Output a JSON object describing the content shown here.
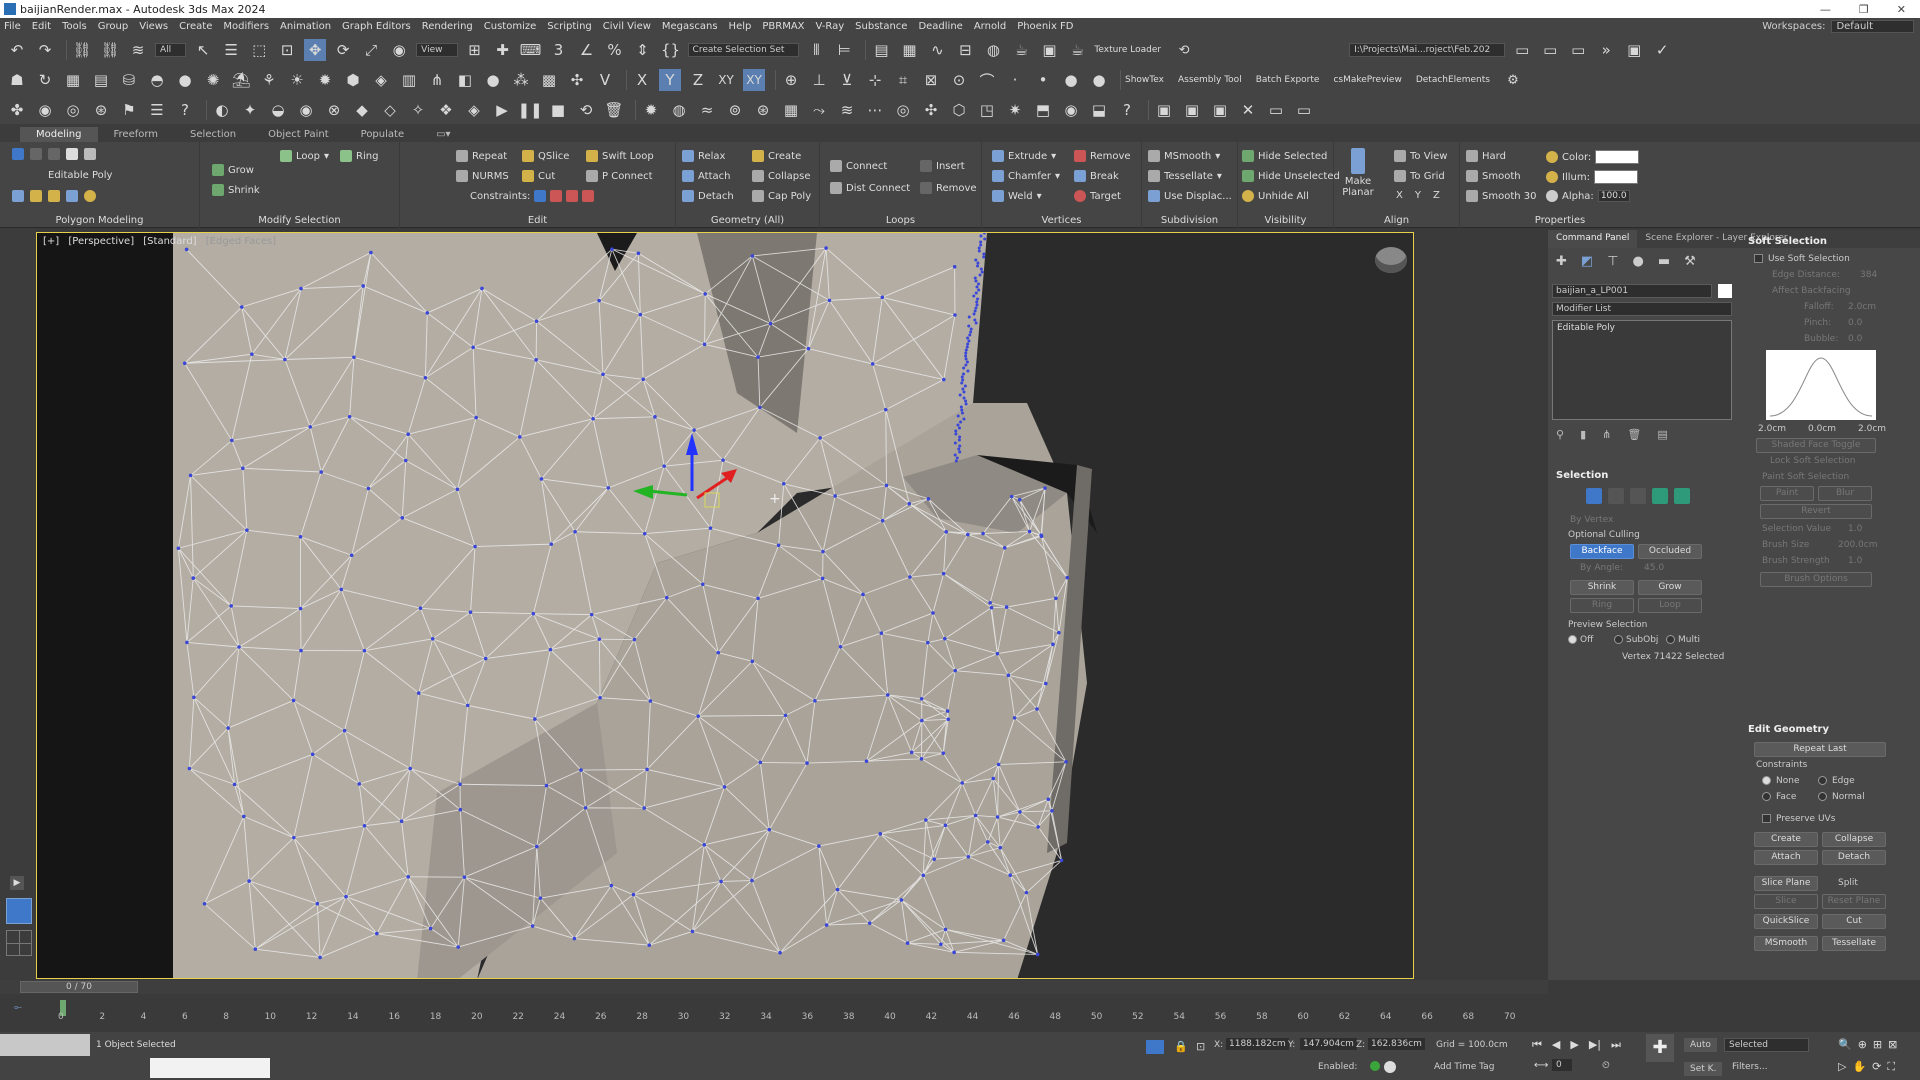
{
  "title": "baijianRender.max - Autodesk 3ds Max 2024",
  "menu": [
    "File",
    "Edit",
    "Tools",
    "Group",
    "Views",
    "Create",
    "Modifiers",
    "Animation",
    "Graph Editors",
    "Rendering",
    "Customize",
    "Scripting",
    "Civil View",
    "Megascans",
    "Help",
    "PBRMAX",
    "V-Ray",
    "Substance",
    "Deadline",
    "Arnold",
    "Phoenix FD"
  ],
  "workspace": {
    "label": "Workspaces:",
    "value": "Default"
  },
  "toolbar1": {
    "selection_filter": "All",
    "ref_coord": "View",
    "selection_set": "Create Selection Set",
    "texture_loader": "Texture Loader",
    "project_path": "I:\\Projects\\Mai...roject\\Feb.202"
  },
  "toolbar2": {
    "show_tex": "ShowTex",
    "assembly_tool": "Assembly Tool",
    "batch_export": "Batch Exporte",
    "cs_make_preview": "csMakePreview",
    "detach_elements": "DetachElements",
    "axis_x": "X",
    "axis_y": "Y",
    "axis_z": "Z",
    "axis_xy": "XY",
    "axis_xy2": "XY"
  },
  "ribbon_tabs": [
    "Modeling",
    "Freeform",
    "Selection",
    "Object Paint",
    "Populate"
  ],
  "ribbon": {
    "polygon_modeling": {
      "label": "Polygon Modeling",
      "object": "Editable Poly"
    },
    "modify_selection": {
      "label": "Modify Selection",
      "grow": "Grow",
      "shrink": "Shrink",
      "loop": "Loop",
      "ring": "Ring"
    },
    "edit": {
      "label": "Edit",
      "repeat": "Repeat",
      "qslice": "QSlice",
      "swift_loop": "Swift Loop",
      "nurms": "NURMS",
      "cut": "Cut",
      "p_connect": "P Connect",
      "constraints": "Constraints:"
    },
    "geometry": {
      "label": "Geometry (All)",
      "relax": "Relax",
      "create": "Create",
      "attach": "Attach",
      "collapse": "Collapse",
      "detach": "Detach",
      "cap_poly": "Cap Poly"
    },
    "loops": {
      "label": "Loops",
      "connect": "Connect",
      "dist_connect": "Dist Connect",
      "insert": "Insert",
      "remove": "Remove"
    },
    "vertices": {
      "label": "Vertices",
      "extrude": "Extrude",
      "chamfer": "Chamfer",
      "weld": "Weld",
      "remove": "Remove",
      "break": "Break",
      "target": "Target"
    },
    "subdivision": {
      "label": "Subdivision",
      "msmooth": "MSmooth",
      "tessellate": "Tessellate",
      "use_displac": "Use Displac..."
    },
    "visibility": {
      "label": "Visibility",
      "hide_selected": "Hide Selected",
      "hide_unselected": "Hide Unselected",
      "unhide_all": "Unhide All"
    },
    "align": {
      "label": "Align",
      "make_planar": "Make Planar",
      "to_view": "To View",
      "to_grid": "To Grid",
      "x": "X",
      "y": "Y",
      "z": "Z"
    },
    "properties": {
      "label": "Properties",
      "hard": "Hard",
      "smooth": "Smooth",
      "smooth30": "Smooth 30",
      "color": "Color:",
      "illum": "Illum:",
      "alpha": "Alpha:",
      "alpha_value": "100.0"
    }
  },
  "viewport": {
    "labels": [
      "[+]",
      "[Perspective]",
      "[Standard]",
      "[Edged Faces]"
    ]
  },
  "command_panel": {
    "tabs": [
      "Command Panel",
      "Scene Explorer - Layer Explorer"
    ],
    "object_name": "baijian_a_LP001",
    "modifier_list": "Modifier List",
    "stack_item": "Editable Poly",
    "selection": {
      "header": "Selection",
      "by_vertex": "By Vertex",
      "optional_culling": "Optional Culling",
      "backface": "Backface",
      "occluded": "Occluded",
      "by_angle": "By Angle:",
      "angle": "45.0",
      "shrink": "Shrink",
      "grow": "Grow",
      "ring": "Ring",
      "loop": "Loop",
      "preview": "Preview Selection",
      "off": "Off",
      "subobj": "SubObj",
      "multi": "Multi",
      "status": "Vertex 71422 Selected"
    },
    "soft": {
      "header": "Soft Selection",
      "use": "Use Soft Selection",
      "edge_distance": "Edge Distance:",
      "edge_value": "384",
      "affect_backfacing": "Affect Backfacing",
      "falloff": "Falloff:",
      "falloff_value": "2.0cm",
      "pinch": "Pinch:",
      "pinch_value": "0.0",
      "bubble": "Bubble:",
      "bubble_value": "0.0",
      "curve_left": "2.0cm",
      "curve_mid": "0.0cm",
      "curve_right": "2.0cm",
      "shaded_face": "Shaded Face Toggle",
      "lock": "Lock Soft Selection",
      "paint_header": "Paint Soft Selection",
      "paint": "Paint",
      "blur": "Blur",
      "revert": "Revert",
      "sel_value": "Selection Value",
      "sel_value_v": "1.0",
      "brush_size": "Brush Size",
      "brush_size_v": "200.0cm",
      "brush_strength": "Brush Strength",
      "brush_strength_v": "1.0",
      "brush_options": "Brush Options"
    },
    "edit_geometry": {
      "header": "Edit Geometry",
      "repeat_last": "Repeat Last",
      "constraints": "Constraints",
      "none": "None",
      "edge": "Edge",
      "face": "Face",
      "normal": "Normal",
      "preserve_uvs": "Preserve UVs",
      "create": "Create",
      "collapse": "Collapse",
      "attach": "Attach",
      "detach": "Detach",
      "slice_plane": "Slice Plane",
      "split": "Split",
      "slice": "Slice",
      "reset_plane": "Reset Plane",
      "quickslice": "QuickSlice",
      "cut": "Cut",
      "msmooth": "MSmooth",
      "tessellate": "Tessellate"
    }
  },
  "timeline": {
    "frame": "0 / 70",
    "ticks": [
      "0",
      "2",
      "4",
      "6",
      "8",
      "10",
      "12",
      "14",
      "16",
      "18",
      "20",
      "22",
      "24",
      "26",
      "28",
      "30",
      "32",
      "34",
      "36",
      "38",
      "40",
      "42",
      "44",
      "46",
      "48",
      "50",
      "52",
      "54",
      "56",
      "58",
      "60",
      "62",
      "64",
      "66",
      "68",
      "70"
    ]
  },
  "status": {
    "objects": "1 Object Selected",
    "x_label": "X:",
    "x": "1188.182cm",
    "y_label": "Y:",
    "y": "147.904cm",
    "z_label": "Z:",
    "z": "162.836cm",
    "grid": "Grid = 100.0cm",
    "enabled": "Enabled:",
    "add_time_tag": "Add Time Tag",
    "auto": "Auto",
    "set_k": "Set K.",
    "selected": "Selected",
    "filters": "Filters...",
    "frame_value": "0"
  }
}
